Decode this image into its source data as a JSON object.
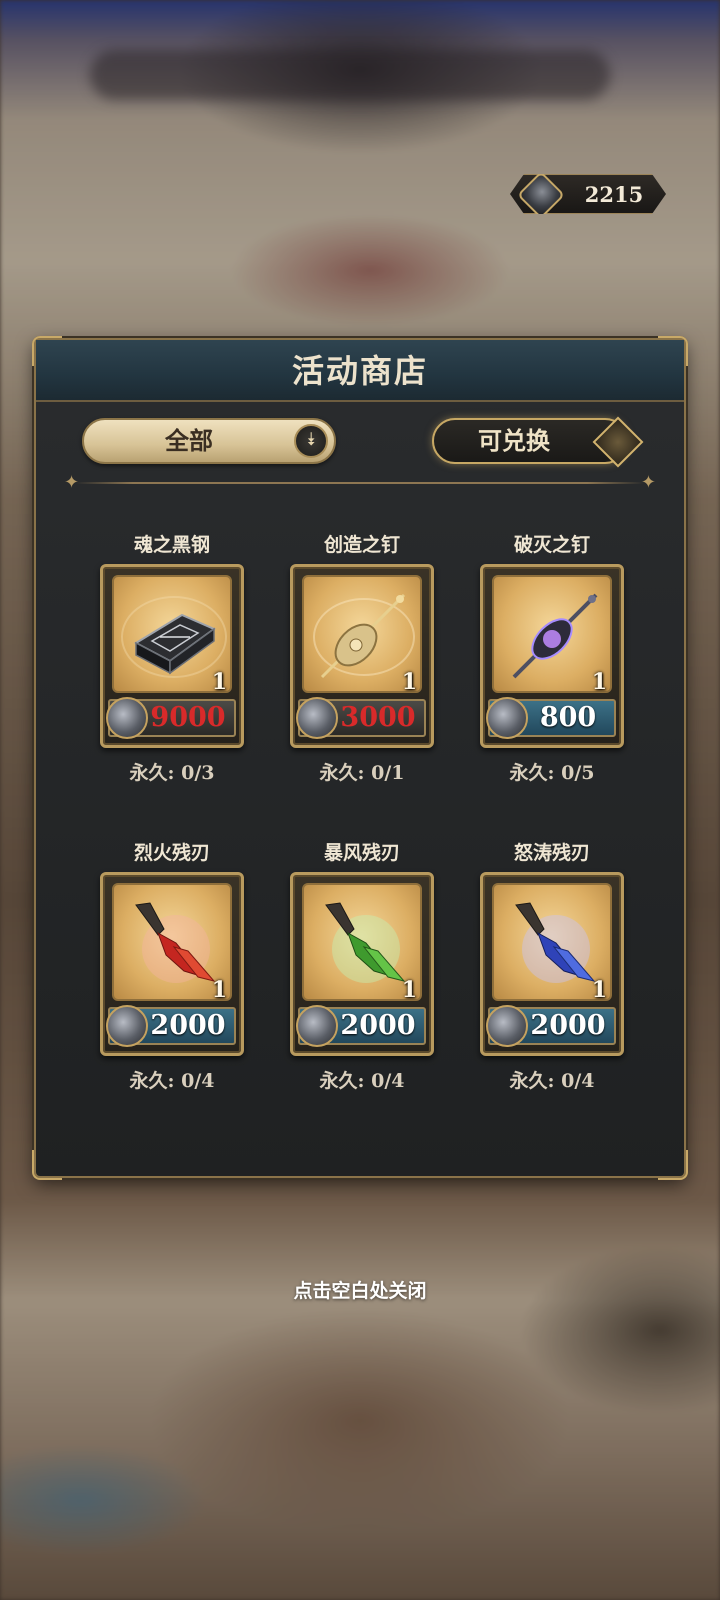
{
  "currency": {
    "icon": "coin-icon",
    "amount": "2215"
  },
  "panel": {
    "title": "活动商店",
    "filter": {
      "selected": "全部",
      "icon": "double-chevron-down-icon"
    },
    "exchange_button": "可兑换"
  },
  "items": [
    {
      "name": "魂之黑钢",
      "count": "1",
      "price": "9000",
      "limit": "永久: 0/3",
      "affordable": false
    },
    {
      "name": "创造之钉",
      "count": "1",
      "price": "3000",
      "limit": "永久: 0/1",
      "affordable": false
    },
    {
      "name": "破灭之钉",
      "count": "1",
      "price": "800",
      "limit": "永久: 0/5",
      "affordable": true
    },
    {
      "name": "烈火残刃",
      "count": "1",
      "price": "2000",
      "limit": "永久: 0/4",
      "affordable": true
    },
    {
      "name": "暴风残刃",
      "count": "1",
      "price": "2000",
      "limit": "永久: 0/4",
      "affordable": true
    },
    {
      "name": "怒涛残刃",
      "count": "1",
      "price": "2000",
      "limit": "永久: 0/4",
      "affordable": true
    }
  ],
  "close_hint": "点击空白处关闭",
  "colors": {
    "unaffordable_price": "#d82a2a",
    "affordable_price": "#ffffff",
    "gold_trim": "#b89a5e"
  }
}
